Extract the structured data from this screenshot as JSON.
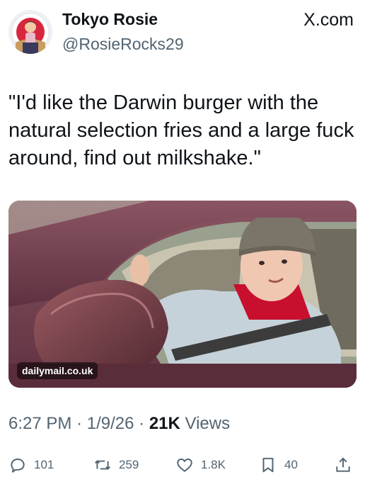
{
  "author": {
    "name": "Tokyo Rosie",
    "handle": "@RosieRocks29"
  },
  "brand": "X.com",
  "tweet": {
    "text": "\"I'd like the Darwin burger with the natural selection fries and a large fuck around, find out milkshake.\""
  },
  "media": {
    "source_badge": "dailymail.co.uk"
  },
  "meta": {
    "time": "6:27 PM",
    "date": "1/9/26",
    "views_count": "21K",
    "views_label": "Views",
    "separator": "·"
  },
  "actions": {
    "replies": "101",
    "reposts": "259",
    "likes": "1.8K",
    "bookmarks": "40"
  },
  "colors": {
    "text": "#0f1419",
    "secondary": "#536471"
  }
}
